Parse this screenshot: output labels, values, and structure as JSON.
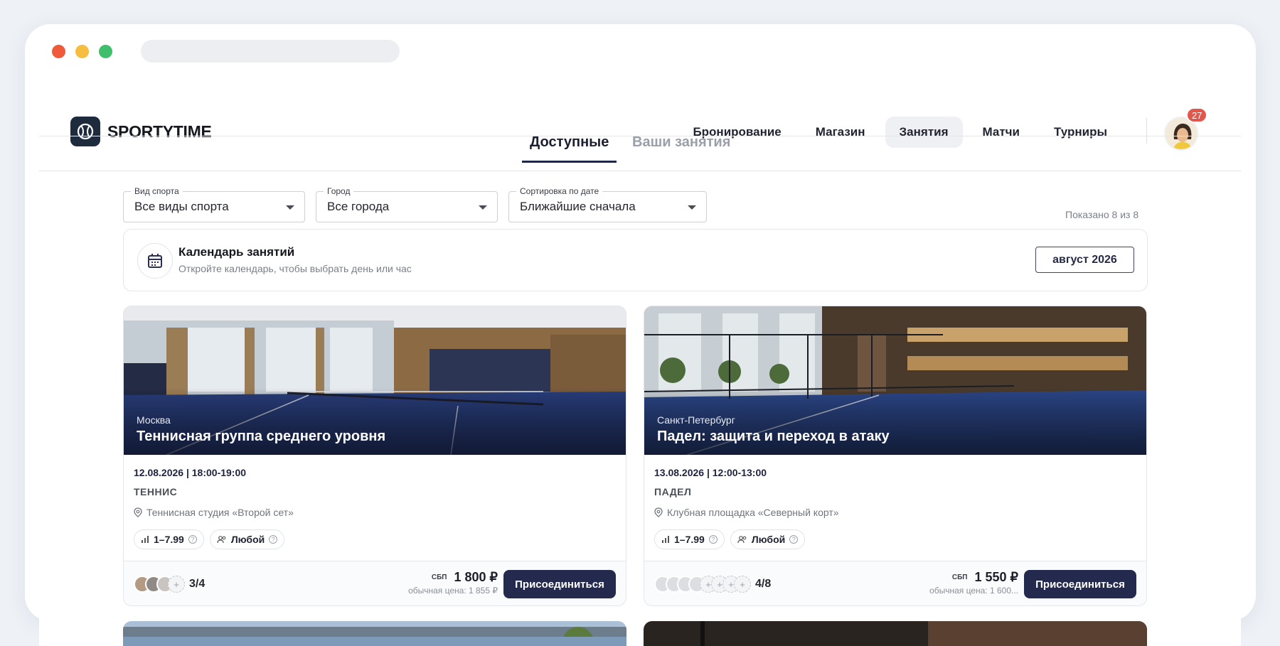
{
  "brand": {
    "name": "SPORTYTIME"
  },
  "nav": {
    "items": [
      "Бронирование",
      "Магазин",
      "Занятия",
      "Матчи",
      "Турниры"
    ],
    "active": "Занятия"
  },
  "notifications": {
    "count": "27"
  },
  "tabs": {
    "available": "Доступные",
    "mine": "Ваши занятия"
  },
  "filters": {
    "sport": {
      "label": "Вид спорта",
      "value": "Все виды спорта"
    },
    "city": {
      "label": "Город",
      "value": "Все города"
    },
    "sort": {
      "label": "Сортировка по дате",
      "value": "Ближайшие сначала"
    }
  },
  "results": {
    "shown": "Показано 8 из 8"
  },
  "calendar": {
    "title": "Календарь занятий",
    "subtitle": "Откройте календарь, чтобы выбрать день или час",
    "month": "август 2026"
  },
  "cards": [
    {
      "city": "Москва",
      "title": "Теннисная группа среднего уровня",
      "datetime": "12.08.2026 | 18:00-19:00",
      "sport": "ТЕННИС",
      "place": "Теннисная студия «Второй сет»",
      "level": "1–7.99",
      "gender": "Любой",
      "participants": "3/4",
      "pay": "СБП",
      "price": "1 800 ₽",
      "regular": "обычная цена: 1 855 ₽",
      "join": "Присоединиться"
    },
    {
      "city": "Санкт-Петербург",
      "title": "Падел: защита и переход в атаку",
      "datetime": "13.08.2026 | 12:00-13:00",
      "sport": "ПАДЕЛ",
      "place": "Клубная площадка «Северный корт»",
      "level": "1–7.99",
      "gender": "Любой",
      "participants": "4/8",
      "pay": "СБП",
      "price": "1 550 ₽",
      "regular": "обычная цена: 1 600...",
      "join": "Присоединиться"
    }
  ],
  "colors": {
    "accent": "#232a4e",
    "badge": "#e2574c",
    "logo_bg": "#1d2b3d"
  }
}
